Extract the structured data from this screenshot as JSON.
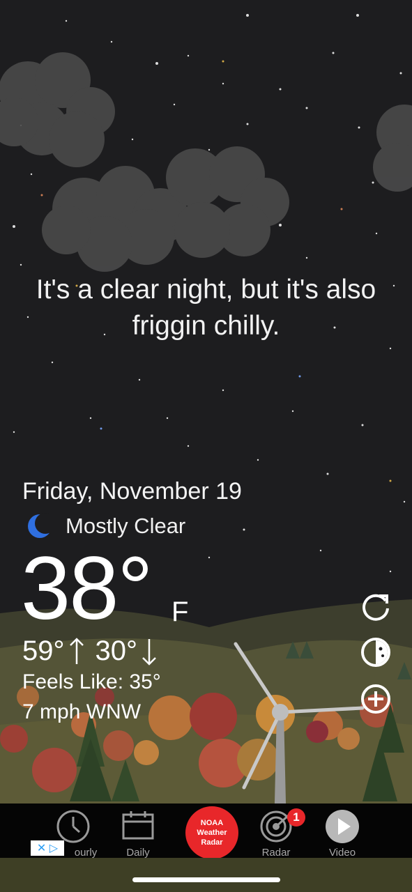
{
  "headline": "It's a clear night, but it's also friggin chilly.",
  "weather": {
    "date": "Friday, November 19",
    "condition": "Mostly Clear",
    "condition_icon": "moon-icon",
    "temperature": "38°",
    "unit": "F",
    "high": "59°",
    "low": "30°",
    "feels_like": "Feels Like: 35°",
    "wind": "7 mph WNW"
  },
  "side_actions": [
    {
      "icon": "refresh-icon"
    },
    {
      "icon": "theme-icon"
    },
    {
      "icon": "add-icon"
    }
  ],
  "tabs": {
    "hourly": "ourly",
    "daily": "Daily",
    "noaa": "NOAA Weather Radar",
    "radar": "Radar",
    "radar_badge": "1",
    "video": "Video"
  },
  "ad_choices": "✕ ▷",
  "colors": {
    "sky": "#1d1d1f",
    "accent_red": "#e8272a",
    "moon_blue": "#2f6fe0",
    "grass": "#5d5b37"
  }
}
